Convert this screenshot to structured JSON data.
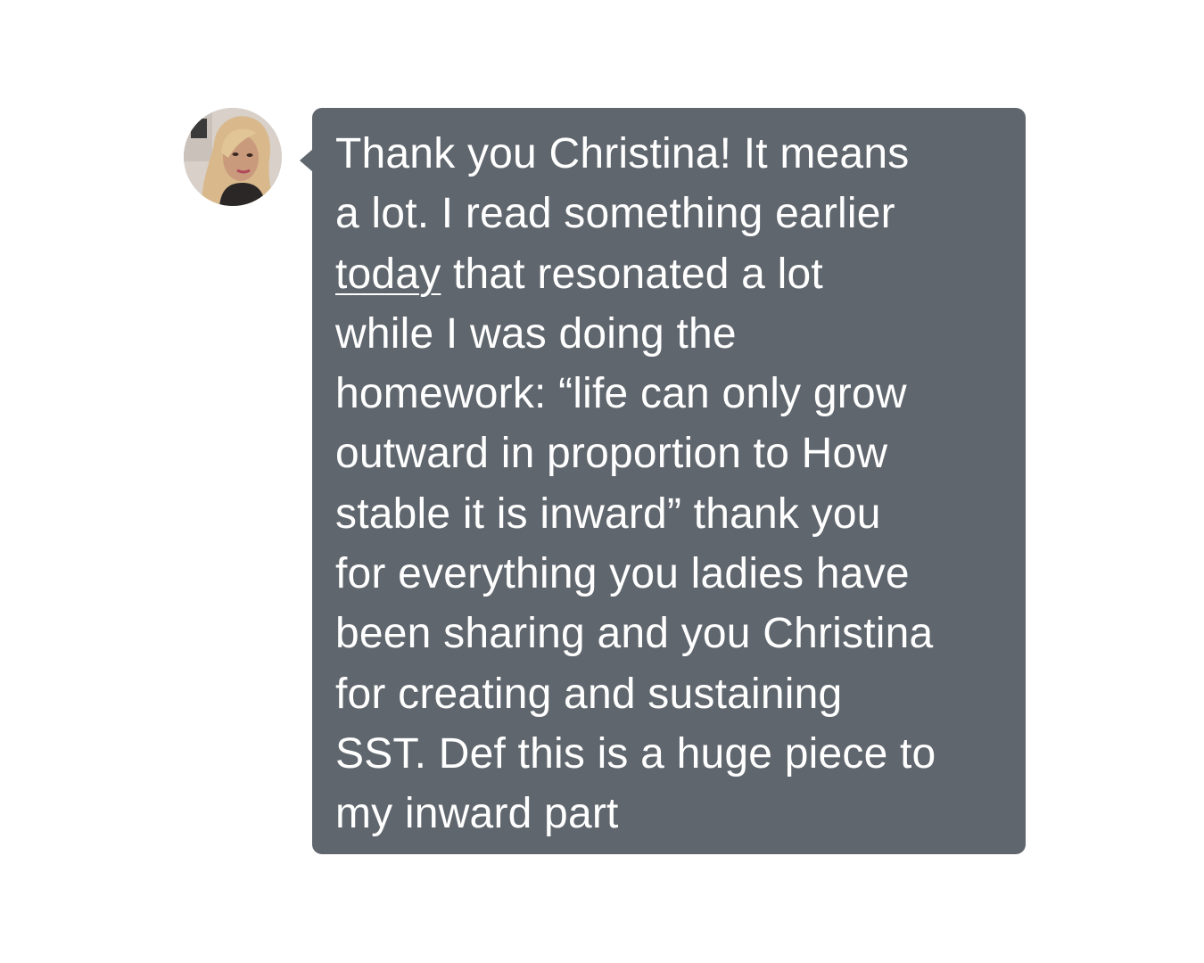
{
  "message": {
    "bubble_color": "#5f666d",
    "text_color": "#ffffff",
    "lines": [
      {
        "text": "Thank you Christina! It means"
      },
      {
        "text": "a lot. I read something earlier"
      },
      {
        "link": "today",
        "text": " that resonated a lot"
      },
      {
        "text": "while I was doing the"
      },
      {
        "text": "homework: “life can only grow"
      },
      {
        "text": "outward in proportion to How"
      },
      {
        "text": "stable it is inward” thank you"
      },
      {
        "text": "for everything you ladies have"
      },
      {
        "text": "been sharing and you Christina"
      },
      {
        "text": "for creating and sustaining"
      },
      {
        "text": "SST. Def this is a huge piece to"
      },
      {
        "text": "my inward part"
      }
    ]
  },
  "avatar": {
    "icon": "user-photo-avatar"
  }
}
